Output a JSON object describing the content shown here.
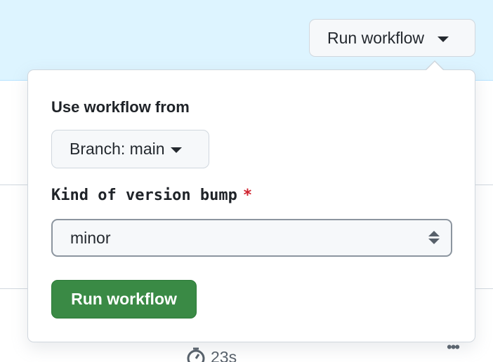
{
  "header": {
    "run_workflow_button": "Run workflow"
  },
  "popover": {
    "use_workflow_from_label": "Use workflow from",
    "branch_button": "Branch: main",
    "input_label": "Kind of version bump",
    "required_marker": "*",
    "selected_value": "minor",
    "submit_button": "Run workflow"
  },
  "background": {
    "duration": "23s",
    "more_icon": "kebab-horizontal-icon"
  },
  "colors": {
    "banner": "#ddf4ff",
    "primary_button": "#3a8a45",
    "required": "#cf222e"
  }
}
